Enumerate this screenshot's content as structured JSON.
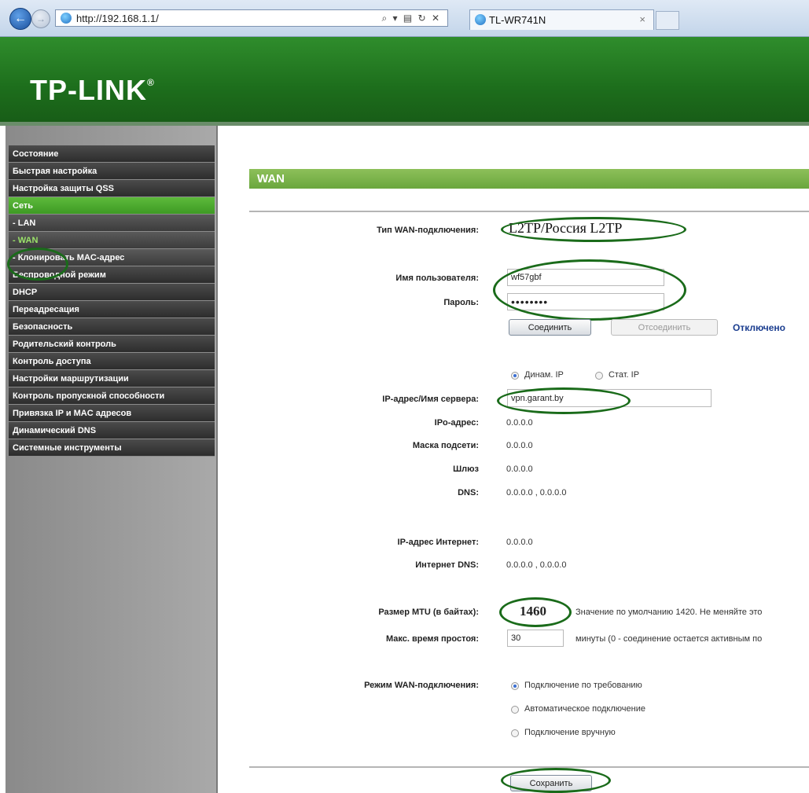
{
  "browser": {
    "url": "http://192.168.1.1/",
    "address_tools": "⌕ ▾ ▤ ↻ ✕",
    "tab_title": "TL-WR741N",
    "tab_close": "×"
  },
  "header": {
    "logo": "TP-LINK",
    "logo_mark": "®"
  },
  "sidebar": {
    "items": [
      {
        "label": "Состояние"
      },
      {
        "label": "Быстрая настройка"
      },
      {
        "label": "Настройка защиты QSS"
      },
      {
        "label": "Сеть"
      },
      {
        "label": "- LAN"
      },
      {
        "label": "- WAN"
      },
      {
        "label": "- Клонировать MAC-адрес"
      },
      {
        "label": "Беспроводной режим"
      },
      {
        "label": "DHCP"
      },
      {
        "label": "Переадресация"
      },
      {
        "label": "Безопасность"
      },
      {
        "label": "Родительский контроль"
      },
      {
        "label": "Контроль доступа"
      },
      {
        "label": "Настройки маршрутизации"
      },
      {
        "label": "Контроль пропускной способности"
      },
      {
        "label": "Привязка IP и MAC адресов"
      },
      {
        "label": "Динамический DNS"
      },
      {
        "label": "Системные инструменты"
      }
    ]
  },
  "wan": {
    "section_title": "WAN",
    "conn_type_label": "Тип WAN-подключения:",
    "conn_type_value": "L2TP/Россия L2TP",
    "username_label": "Имя пользователя:",
    "username_value": "wf57gbf",
    "password_label": "Пароль:",
    "password_value": "••••••••",
    "connect_label": "Соединить",
    "disconnect_label": "Отсоединить",
    "status_text": "Отключено",
    "ip_mode_dynamic": "Динам. IP",
    "ip_mode_static": "Стат. IP",
    "server_label": "IP-адрес/Имя сервера:",
    "server_value": "vpn.garant.by",
    "ip_label": "IPо-адрес:",
    "ip_value": "0.0.0.0",
    "mask_label": "Маска подсети:",
    "mask_value": "0.0.0.0",
    "gateway_label": "Шлюз",
    "gateway_value": "0.0.0.0",
    "dns_label": "DNS:",
    "dns_value": "0.0.0.0 , 0.0.0.0",
    "inet_ip_label": "IP-адрес Интернет:",
    "inet_ip_value": "0.0.0.0",
    "inet_dns_label": "Интернет DNS:",
    "inet_dns_value": "0.0.0.0 , 0.0.0.0",
    "mtu_label": "Размер MTU (в байтах):",
    "mtu_value": "1460",
    "mtu_hint": "Значение по умолчанию 1420. Не меняйте это",
    "idle_label": "Макс. время простоя:",
    "idle_value": "30",
    "idle_hint": "минуты (0 - соединение остается активным по",
    "mode_label": "Режим WAN-подключения:",
    "mode_on_demand": "Подключение по требованию",
    "mode_auto": "Автоматическое подключение",
    "mode_manual": "Подключение вручную",
    "save_label": "Сохранить"
  },
  "colors": {
    "header_green": "#1d6e1c",
    "section_green": "#7ab24a",
    "annotation_green": "#1a6b1a"
  }
}
